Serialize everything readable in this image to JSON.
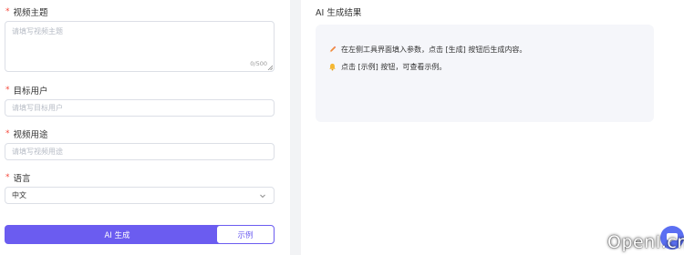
{
  "form": {
    "topic": {
      "label": "视频主题",
      "required_mark": "*",
      "placeholder": "请填写视频主题",
      "counter": "0/500"
    },
    "audience": {
      "label": "目标用户",
      "required_mark": "*",
      "placeholder": "请填写目标用户"
    },
    "purpose": {
      "label": "视频用途",
      "required_mark": "*",
      "placeholder": "请填写视频用途"
    },
    "language": {
      "label": "语言",
      "required_mark": "*",
      "value": "中文"
    },
    "generate_label": "AI 生成",
    "example_label": "示例"
  },
  "result": {
    "title": "AI 生成结果",
    "tip1": "在左侧工具界面填入参数，点击 [生成] 按钮后生成内容。",
    "tip2": "点击 [示例] 按钮，可查看示例。"
  },
  "watermark": "OpenI.cn",
  "colors": {
    "accent": "#6b5cf0",
    "required": "#f5483b",
    "panel_bg": "#f5f6fa",
    "page_bg": "#f2f3f5"
  },
  "icons": {
    "tip1": "pencil-icon",
    "tip2": "bell-icon",
    "fab": "chat-icon"
  }
}
